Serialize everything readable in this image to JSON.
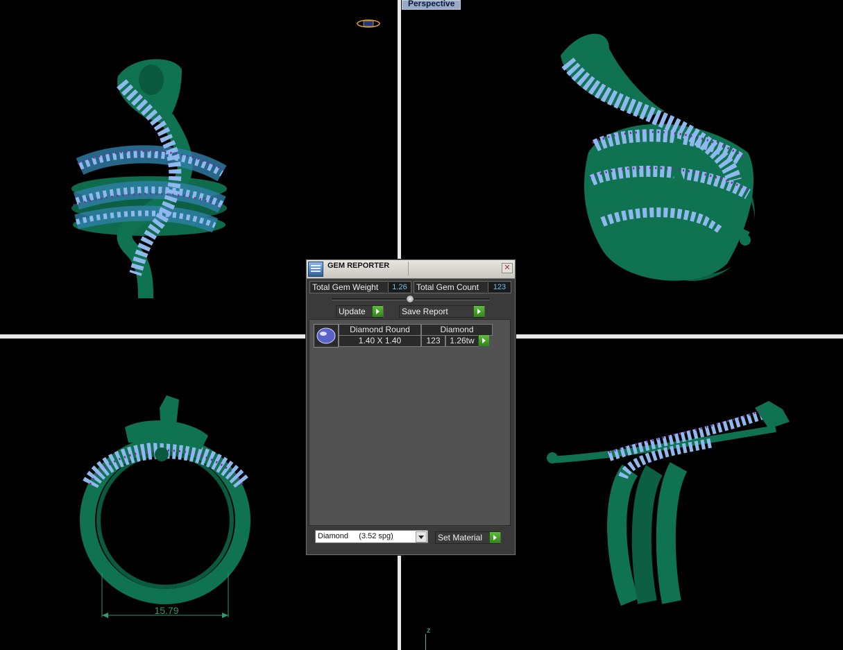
{
  "viewport": {
    "perspective_label": "Perspective",
    "dimension_value": "15.79",
    "axis_label": "z"
  },
  "colors": {
    "metal": "#0e6b4c",
    "gem": "#8fb8ee",
    "prong": "#7a2aa0",
    "dimension": "#2f9a6a"
  },
  "gem_reporter": {
    "title": "GEM REPORTER",
    "close_icon": "close-icon",
    "total_weight_label": "Total Gem Weight",
    "total_weight_value": "1.26",
    "total_count_label": "Total Gem Count",
    "total_count_value": "123",
    "update_label": "Update",
    "save_report_label": "Save Report",
    "gems": [
      {
        "shape": "Diamond Round",
        "material": "Diamond",
        "size": "1.40 X 1.40",
        "count": "123",
        "weight": "1.26tw"
      }
    ],
    "material_select": "Diamond     (3.52 spg)",
    "set_material_label": "Set Material"
  }
}
